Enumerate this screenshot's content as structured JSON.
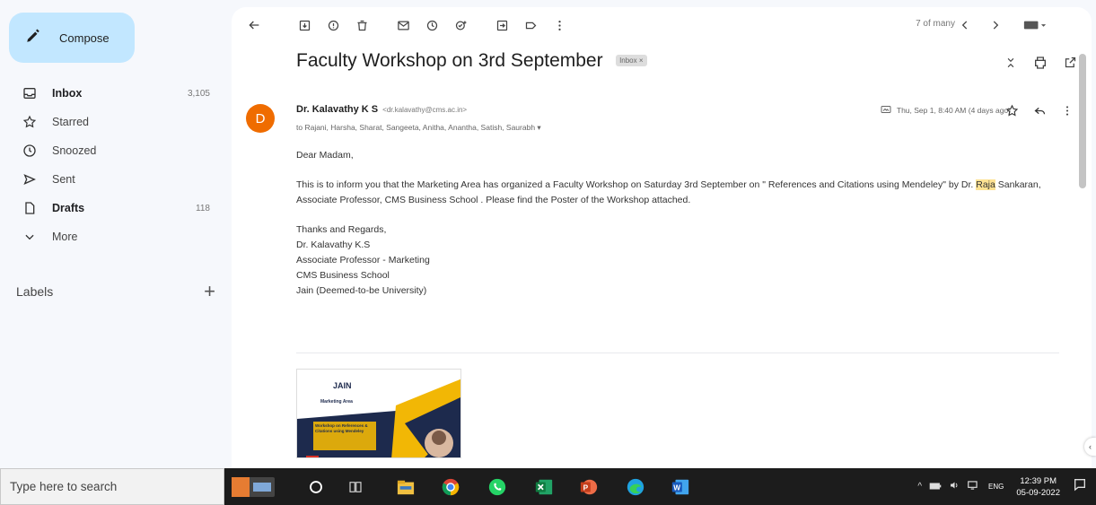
{
  "sidebar": {
    "compose_label": "Compose",
    "items": [
      {
        "label": "Inbox",
        "count": "3,105",
        "icon": "inbox-icon"
      },
      {
        "label": "Starred",
        "count": "",
        "icon": "star-icon"
      },
      {
        "label": "Snoozed",
        "count": "",
        "icon": "clock-icon"
      },
      {
        "label": "Sent",
        "count": "",
        "icon": "send-icon"
      },
      {
        "label": "Drafts",
        "count": "118",
        "icon": "draft-icon"
      },
      {
        "label": "More",
        "count": "",
        "icon": "chevron-down-icon"
      }
    ],
    "labels_heading": "Labels"
  },
  "toolbar": {
    "pager_text": "7 of many"
  },
  "email": {
    "subject": "Faculty Workshop on 3rd September",
    "badge": "Inbox ×",
    "avatar_letter": "D",
    "sender_name": "Dr. Kalavathy K S",
    "sender_email": "<dr.kalavathy@cms.ac.in>",
    "recipients": "to Rajani, Harsha, Sharat, Sangeeta, Anitha, Anantha, Satish, Saurabh ▾",
    "date": "Thu, Sep 1, 8:40 AM (4 days ago)",
    "greeting": "Dear Madam,",
    "body_part1": "This is to inform you that  the Marketing Area has organized a Faculty Workshop on Saturday 3rd September on \" References and Citations using Mendeley\" by Dr. ",
    "body_highlight": "Raja",
    "body_part2": " Sankaran, Associate Professor, CMS Business School . Please find the Poster of the Workshop attached.",
    "signature": [
      "Thanks and Regards,",
      "Dr. Kalavathy K.S",
      "Associate Professor - Marketing",
      "CMS Business School",
      "Jain (Deemed-to-be University)"
    ],
    "attachment": {
      "logo_text": "JAIN",
      "area_text": "Marketing Area",
      "title_text": "Workshop on References & Citations using Mendeley"
    }
  },
  "taskbar": {
    "search_placeholder": "Type here to search",
    "time": "12:39 PM",
    "date": "05-09-2022",
    "lang": "ENG"
  },
  "colors": {
    "compose_bg": "#c2e7ff",
    "avatar_bg": "#ef6c00",
    "highlight": "#fde293",
    "taskbar_bg": "#1c1c1c"
  }
}
